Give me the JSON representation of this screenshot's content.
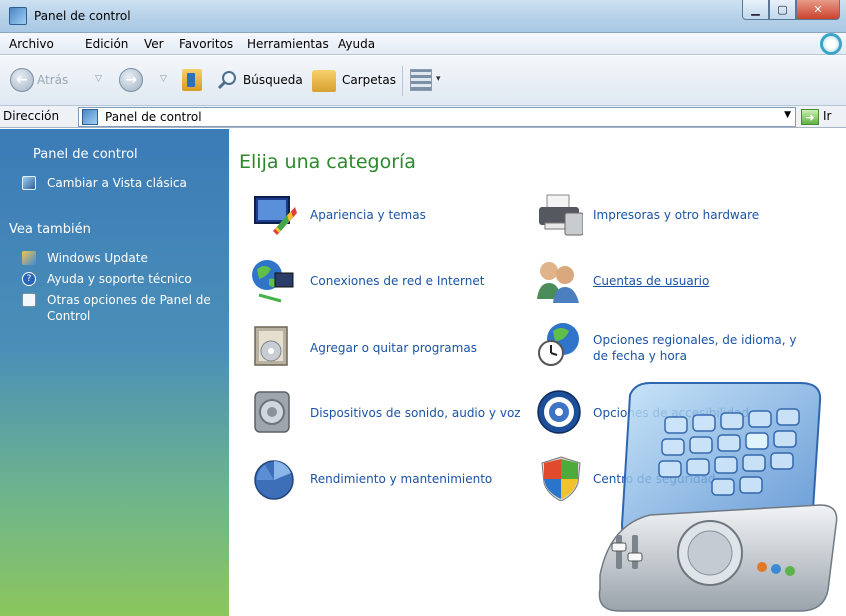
{
  "window": {
    "title": "Panel de control"
  },
  "menu": [
    "Archivo",
    "Edición",
    "Ver",
    "Favoritos",
    "Herramientas",
    "Ayuda"
  ],
  "toolbar": {
    "back_label": "Atrás",
    "search_label": "Búsqueda",
    "folders_label": "Carpetas"
  },
  "address": {
    "label": "Dirección",
    "value": "Panel de control",
    "go_label": "Ir"
  },
  "sidebar": {
    "title": "Panel de control",
    "switch_link": "Cambiar a Vista clásica",
    "see_also_heading": "Vea también",
    "see_also": [
      "Windows Update",
      "Ayuda y soporte técnico",
      "Otras opciones de Panel de Control"
    ]
  },
  "main": {
    "title": "Elija una categoría",
    "categories_left": [
      "Apariencia y temas",
      "Conexiones de red e Internet",
      "Agregar o quitar programas",
      "Dispositivos de sonido, audio y voz",
      "Rendimiento y mantenimiento"
    ],
    "categories_right": [
      "Impresoras y otro hardware",
      "Cuentas de usuario",
      "Opciones regionales, de idioma, y de fecha y hora",
      "Opciones de accesibilidad",
      "Centro de seguridad"
    ]
  },
  "colors": {
    "title_green": "#2a8a2a",
    "link_blue": "#1b53a5",
    "sidebar_top": "#3b7bb7",
    "sidebar_bottom": "#8cc75d"
  }
}
